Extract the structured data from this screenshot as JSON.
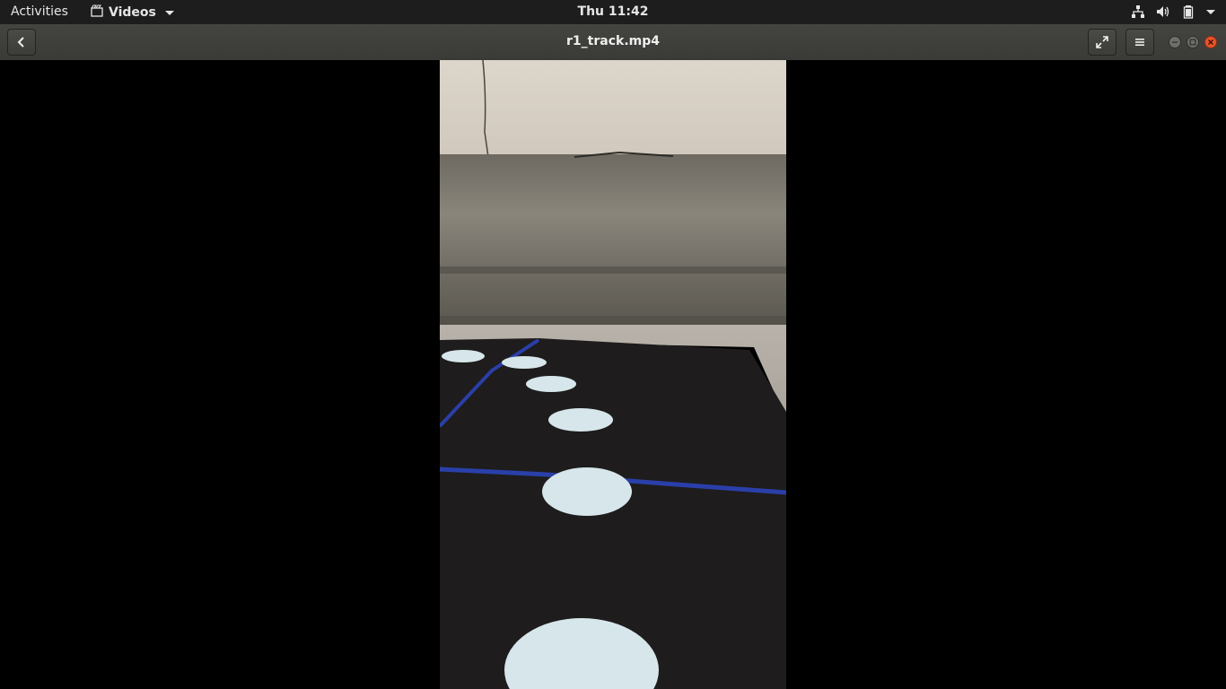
{
  "topbar": {
    "activities": "Activities",
    "app_name": "Videos",
    "clock": "Thu 11:42",
    "tray_icons": [
      "network-icon",
      "volume-icon",
      "battery-icon",
      "system-menu-arrow-icon"
    ]
  },
  "headerbar": {
    "title": "r1_track.mp4",
    "buttons": [
      "back-icon",
      "fullscreen-icon",
      "hamburger-menu-icon"
    ],
    "window_controls": [
      "minimize",
      "maximize",
      "close"
    ]
  },
  "colors": {
    "topbar_bg": "#1d1d1d",
    "headerbar_bg": "#41413e",
    "close_button": "#e9542a",
    "stage_bg": "#000000"
  },
  "video": {
    "description_frame": "video-frame"
  }
}
